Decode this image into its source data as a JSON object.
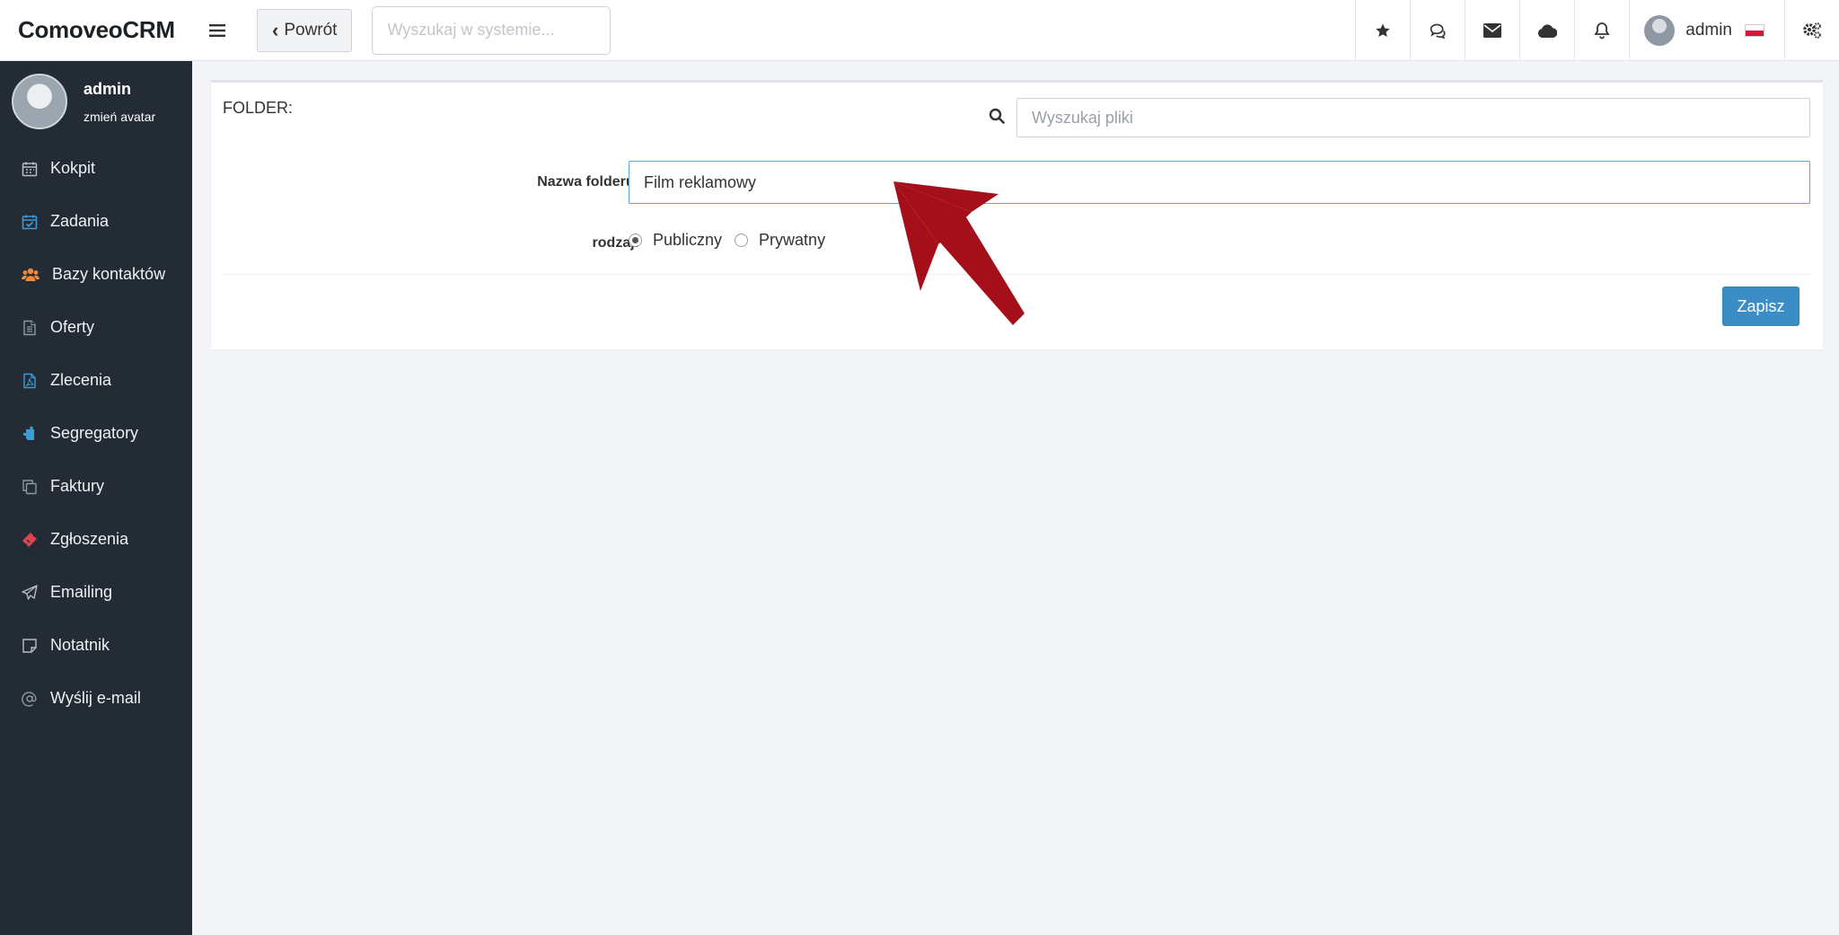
{
  "app": {
    "brand": "ComoveoCRM"
  },
  "header": {
    "back_label": "Powrót",
    "search_placeholder": "Wyszukaj w systemie...",
    "icons": [
      "star-icon",
      "comments-icon",
      "envelope-icon",
      "cloud-icon",
      "bell-icon"
    ],
    "user_name": "admin",
    "settings_icon": "gears-icon"
  },
  "sidebar": {
    "profile_name": "admin",
    "profile_sub": "zmień avatar",
    "items": [
      {
        "label": "Kokpit",
        "icon": "calendar-icon",
        "color": "#b8bec5"
      },
      {
        "label": "Zadania",
        "icon": "calendar-check-icon",
        "color": "#3c9ad6"
      },
      {
        "label": "Bazy kontaktów",
        "icon": "users-icon",
        "color": "#f08a3c"
      },
      {
        "label": "Oferty",
        "icon": "file-text-icon",
        "color": "#8f979f"
      },
      {
        "label": "Zlecenia",
        "icon": "file-pdf-icon",
        "color": "#3c9ad6"
      },
      {
        "label": "Segregatory",
        "icon": "binder-icon",
        "color": "#3c9ad6"
      },
      {
        "label": "Faktury",
        "icon": "copy-icon",
        "color": "#8f979f"
      },
      {
        "label": "Zgłoszenia",
        "icon": "ticket-icon",
        "color": "#e0424e"
      },
      {
        "label": "Emailing",
        "icon": "paper-plane-icon",
        "color": "#b8bec5"
      },
      {
        "label": "Notatnik",
        "icon": "sticky-note-icon",
        "color": "#b8bec5"
      },
      {
        "label": "Wyślij e-mail",
        "icon": "at-icon",
        "color": "#8f979f"
      }
    ]
  },
  "form": {
    "folder_label": "FOLDER:",
    "file_search_placeholder": "Wyszukaj pliki",
    "name_label": "Nazwa folderu:",
    "name_value": "Film reklamowy",
    "type_label": "rodzaj:",
    "options": [
      {
        "label": "Publiczny",
        "checked": true
      },
      {
        "label": "Prywatny",
        "checked": false
      }
    ],
    "save_label": "Zapisz"
  },
  "colors": {
    "sidebar_bg": "#232c35",
    "accent": "#3c8dc5",
    "annotation_arrow": "#a50f1a"
  }
}
